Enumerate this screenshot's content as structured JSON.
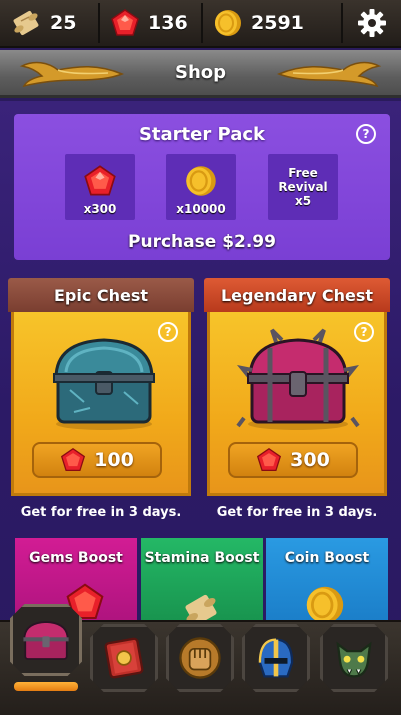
{
  "resources": {
    "scrolls": "25",
    "gems": "136",
    "coins": "2591"
  },
  "header": {
    "title": "Shop"
  },
  "starter_pack": {
    "title": "Starter Pack",
    "items": [
      {
        "icon": "gem-icon",
        "label": "x300"
      },
      {
        "icon": "coin-icon",
        "label": "x10000"
      },
      {
        "icon": "",
        "label_lines": [
          "Free",
          "Revival",
          "x5"
        ]
      }
    ],
    "purchase_label": "Purchase $2.99"
  },
  "chests": [
    {
      "title": "Epic Chest",
      "price": "100",
      "free_text": "Get for free in 3 days.",
      "head_color": "#8a4a3a"
    },
    {
      "title": "Legendary Chest",
      "price": "300",
      "free_text": "Get for free in 3 days.",
      "head_color": "#c94a2a"
    }
  ],
  "boosts": [
    {
      "label": "Gems Boost",
      "color": "#c0168a"
    },
    {
      "label": "Stamina Boost",
      "color": "#1ea35a"
    },
    {
      "label": "Coin Boost",
      "color": "#1d8fd6"
    }
  ],
  "nav": [
    {
      "name": "nav-chest",
      "icon": "chest-icon",
      "active": true
    },
    {
      "name": "nav-book",
      "icon": "book-icon"
    },
    {
      "name": "nav-fist",
      "icon": "fist-icon"
    },
    {
      "name": "nav-helmet",
      "icon": "helmet-icon"
    },
    {
      "name": "nav-monster",
      "icon": "monster-icon"
    }
  ]
}
